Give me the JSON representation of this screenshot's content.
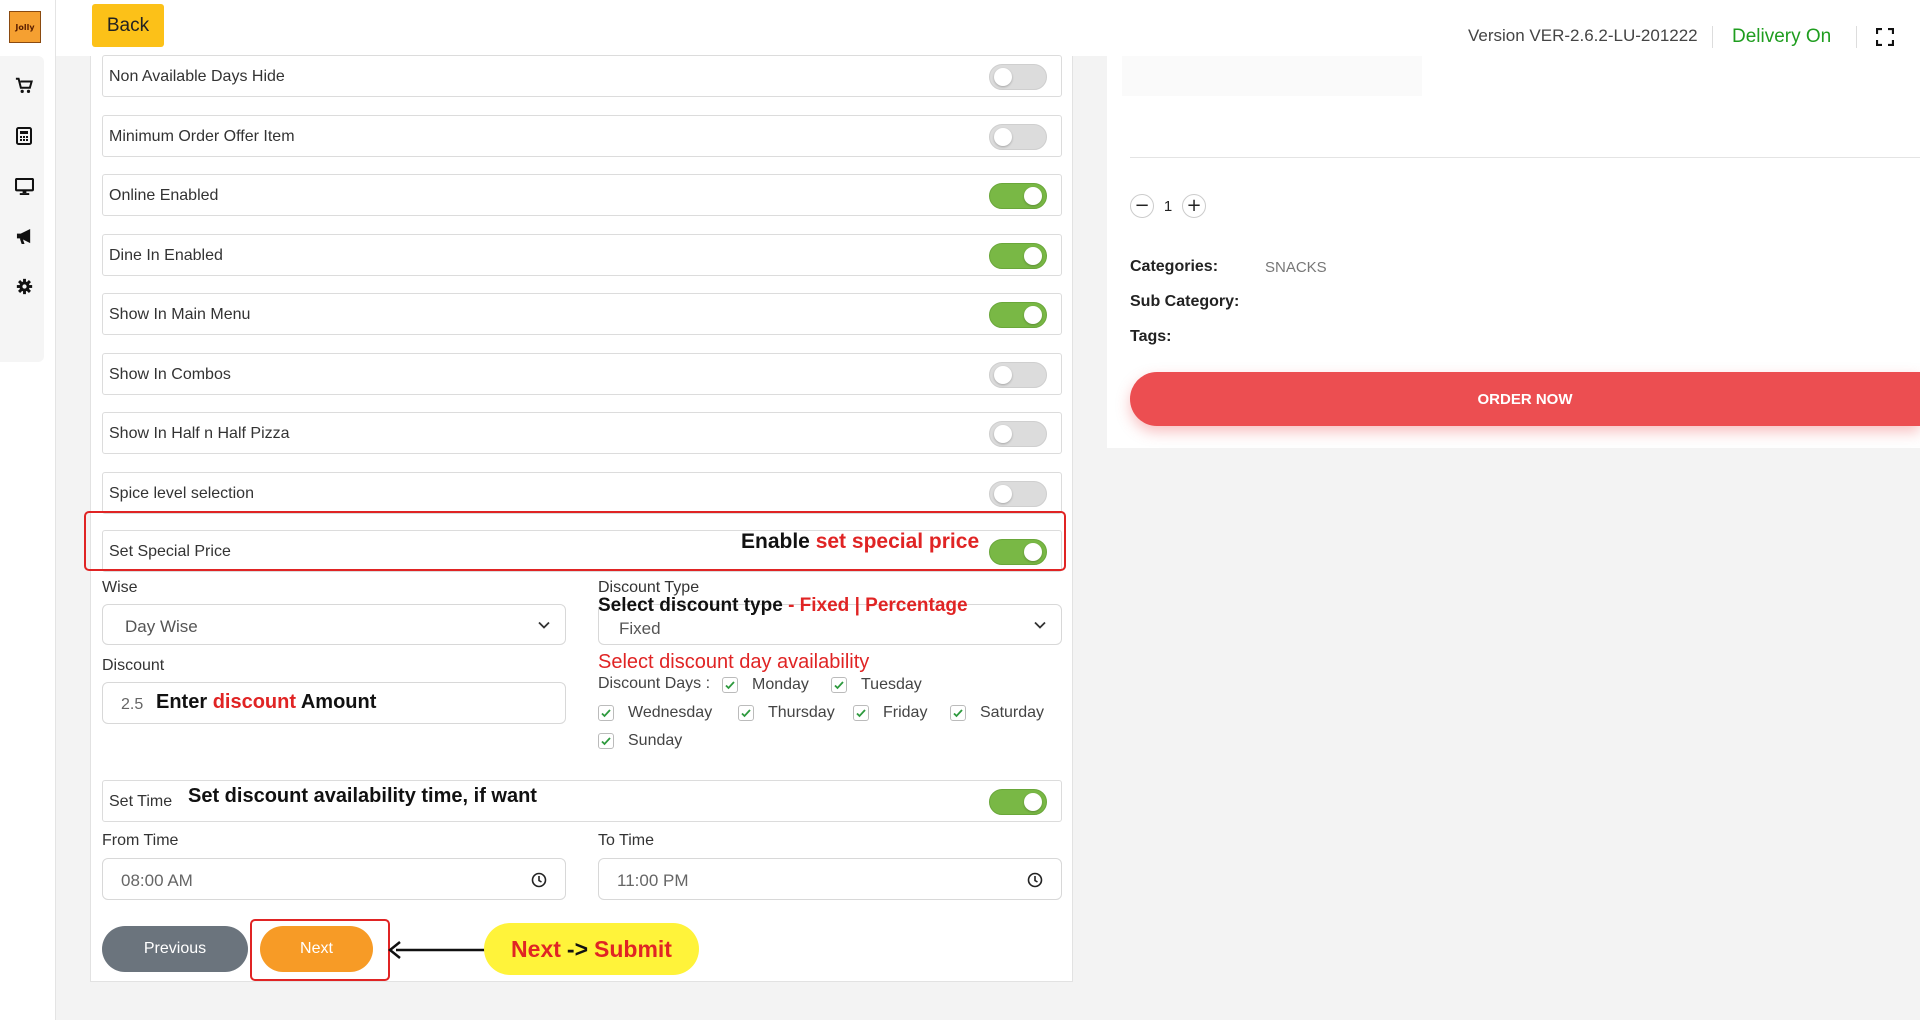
{
  "logo": {
    "text": "Jolly"
  },
  "sidebar": {
    "items": [
      {
        "icon": "cart-icon"
      },
      {
        "icon": "calculator-icon"
      },
      {
        "icon": "monitor-icon"
      },
      {
        "icon": "megaphone-icon"
      },
      {
        "icon": "gear-icon"
      }
    ]
  },
  "topbar": {
    "back_label": "Back",
    "version": "Version VER-2.6.2-LU-201222",
    "delivery": "Delivery On",
    "delivery_color": "#1f9d1f"
  },
  "toggles": [
    {
      "label": "Non Available Days Hide",
      "on": false
    },
    {
      "label": "Minimum Order Offer Item",
      "on": false
    },
    {
      "label": "Online Enabled",
      "on": true
    },
    {
      "label": "Dine In Enabled",
      "on": true
    },
    {
      "label": "Show In Main Menu",
      "on": true
    },
    {
      "label": "Show In Combos",
      "on": false
    },
    {
      "label": "Show In Half n Half Pizza",
      "on": false
    },
    {
      "label": "Spice level selection",
      "on": false
    },
    {
      "label": "Set Special Price",
      "on": true
    }
  ],
  "annotations": {
    "special_price_prefix": "Enable",
    "special_price_red": "set special price",
    "discount_type_prefix": "Select discount type",
    "discount_type_red": "- Fixed | Percentage",
    "discount_amount_prefix": "Enter",
    "discount_amount_red": "discount",
    "discount_amount_suffix": "Amount",
    "days_heading": "Select discount day availability",
    "set_time_note": "Set discount availability time, if want",
    "pill_next": "Next",
    "pill_arrow": "->",
    "pill_submit": "Submit"
  },
  "form": {
    "wise_label": "Wise",
    "wise_value": "Day Wise",
    "discount_type_label": "Discount Type",
    "discount_type_value": "Fixed",
    "discount_label": "Discount",
    "discount_value": "2.5",
    "discount_days_label": "Discount Days :",
    "days": [
      {
        "label": "Monday",
        "checked": true
      },
      {
        "label": "Tuesday",
        "checked": true
      },
      {
        "label": "Wednesday",
        "checked": true
      },
      {
        "label": "Thursday",
        "checked": true
      },
      {
        "label": "Friday",
        "checked": true
      },
      {
        "label": "Saturday",
        "checked": true
      },
      {
        "label": "Sunday",
        "checked": true
      }
    ],
    "set_time_label": "Set Time",
    "set_time_on": true,
    "from_time_label": "From Time",
    "from_time_value": "08:00 AM",
    "to_time_label": "To Time",
    "to_time_value": "11:00 PM"
  },
  "buttons": {
    "previous": "Previous",
    "next": "Next"
  },
  "product": {
    "quantity": "1",
    "categories_label": "Categories:",
    "categories_value": "SNACKS",
    "subcategory_label": "Sub Category:",
    "tags_label": "Tags:",
    "order_now": "ORDER NOW"
  },
  "colors": {
    "accent_yellow": "#fcc118",
    "toggle_on": "#79b845",
    "annotation_red": "#e02424",
    "next_orange": "#f79b26",
    "order_red": "#ec4e51"
  }
}
